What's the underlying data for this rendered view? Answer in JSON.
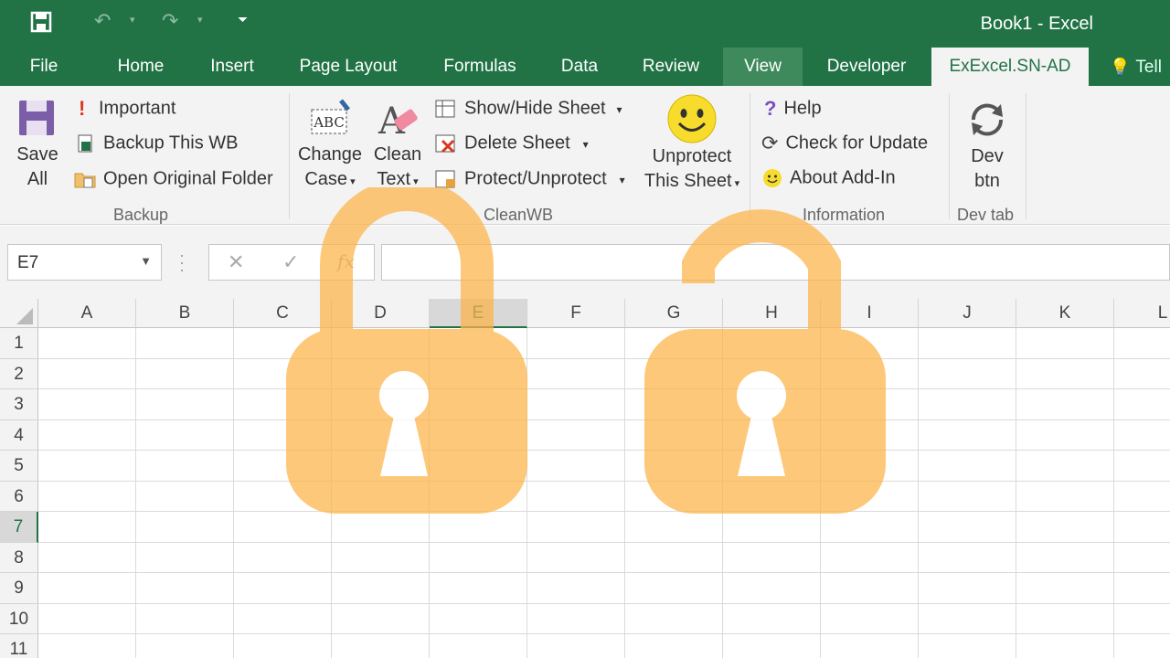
{
  "window": {
    "title": "Book1 - Excel"
  },
  "tabs": [
    {
      "label": "File"
    },
    {
      "label": "Home"
    },
    {
      "label": "Insert"
    },
    {
      "label": "Page Layout"
    },
    {
      "label": "Formulas"
    },
    {
      "label": "Data"
    },
    {
      "label": "Review"
    },
    {
      "label": "View"
    },
    {
      "label": "Developer"
    },
    {
      "label": "ExExcel.SN-AD"
    }
  ],
  "tell_me": "Tell",
  "ribbon": {
    "backup": {
      "save_all": "Save",
      "save_all_2": "All",
      "important": "Important",
      "backup_wb": "Backup This WB",
      "open_folder": "Open Original Folder",
      "label": "Backup"
    },
    "cleanwb": {
      "change_case": "Change",
      "change_case_2": "Case",
      "clean_text": "Clean",
      "clean_text_2": "Text",
      "show_hide": "Show/Hide Sheet",
      "delete_sheet": "Delete Sheet",
      "protect": "Protect/Unprotect",
      "unprotect": "Unprotect",
      "unprotect_2": "This Sheet",
      "label": "CleanWB"
    },
    "information": {
      "help": "Help",
      "check_update": "Check for Update",
      "about": "About Add-In",
      "label": "Information"
    },
    "devtab": {
      "dev_btn": "Dev",
      "dev_btn_2": "btn",
      "label": "Dev tab"
    }
  },
  "formula_bar": {
    "name_box": "E7",
    "formula": ""
  },
  "columns": [
    "A",
    "B",
    "C",
    "D",
    "E",
    "F",
    "G",
    "H",
    "I",
    "J",
    "K",
    "L"
  ],
  "rows": [
    "1",
    "2",
    "3",
    "4",
    "5",
    "6",
    "7",
    "8",
    "9",
    "10",
    "11"
  ],
  "selected_cell": "E7",
  "colors": {
    "accent": "#217346",
    "lock": "#fdc165"
  }
}
